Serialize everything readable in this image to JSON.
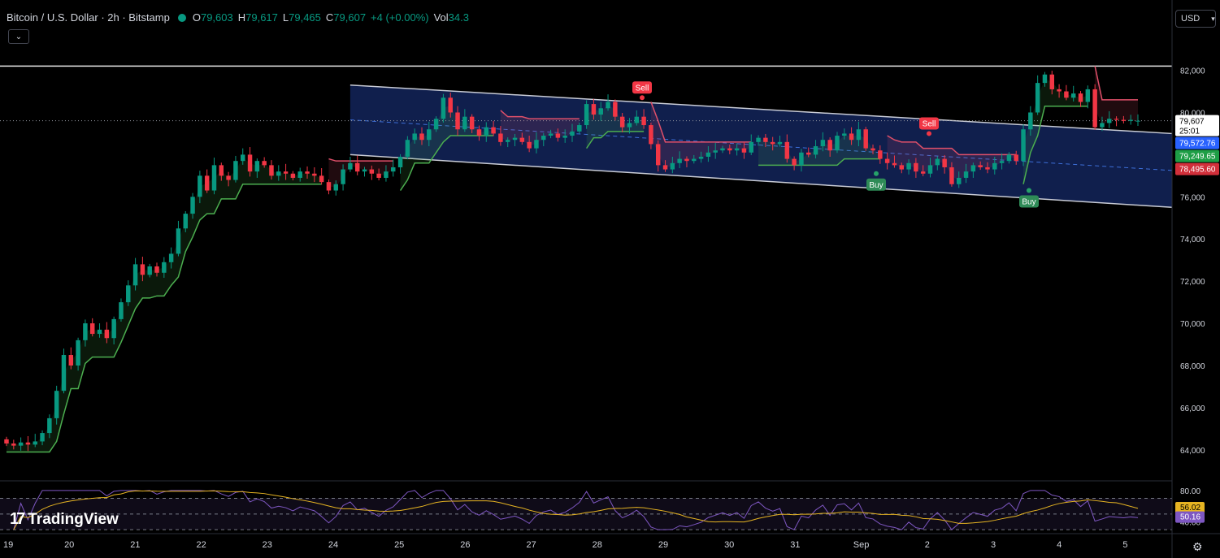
{
  "legend": {
    "symbol": "Bitcoin / U.S. Dollar · 2h · Bitstamp",
    "o_label": "O",
    "o_value": "79,603",
    "h_label": "H",
    "h_value": "79,617",
    "l_label": "L",
    "l_value": "79,465",
    "c_label": "C",
    "c_value": "79,607",
    "change": "+4 (+0.00%)",
    "vol_label": "Vol",
    "vol_value": "34.3"
  },
  "currency": {
    "label": "USD",
    "icon": "chevron-down-icon"
  },
  "collapse_icon": "chevron-down-icon",
  "branding": {
    "logo_text": "TradingView",
    "icon": "tradingview-logo-icon"
  },
  "settings_icon": "gear-icon",
  "colors": {
    "up": "#089981",
    "down": "#f23645",
    "background": "#000000",
    "channel_fill": "#13245a",
    "channel_line": "#c9ccd6",
    "trail_up": "#4caf50",
    "trail_down": "#e0506a",
    "rsi": "#7e57c2",
    "rsi_ma": "#e6b422"
  },
  "chart_data": {
    "type": "candlestick",
    "symbol": "BTCUSD",
    "interval": "2h",
    "x_axis_labels": [
      "19",
      "20",
      "21",
      "22",
      "23",
      "24",
      "25",
      "26",
      "27",
      "28",
      "29",
      "30",
      "31",
      "Sep",
      "2",
      "3",
      "4",
      "5"
    ],
    "y_axis_labels": [
      "82,000",
      "80,000",
      "78,000",
      "76,000",
      "74,000",
      "72,000",
      "70,000",
      "68,000",
      "66,000",
      "64,000"
    ],
    "ylim": [
      62800,
      83100
    ],
    "grid": false,
    "candles": [
      [
        64500,
        64300
      ],
      [
        64300,
        64200
      ],
      [
        64200,
        64350
      ],
      [
        64350,
        64250
      ],
      [
        64250,
        64400
      ],
      [
        64400,
        64800
      ],
      [
        64800,
        65500
      ],
      [
        65500,
        66800
      ],
      [
        66800,
        68500
      ],
      [
        68500,
        68000
      ],
      [
        68000,
        69200
      ],
      [
        69200,
        70000
      ],
      [
        70000,
        69500
      ],
      [
        69500,
        69700
      ],
      [
        69700,
        69300
      ],
      [
        69300,
        70200
      ],
      [
        70200,
        71000
      ],
      [
        71000,
        71800
      ],
      [
        71800,
        72800
      ],
      [
        72800,
        72300
      ],
      [
        72300,
        72700
      ],
      [
        72700,
        72400
      ],
      [
        72400,
        72900
      ],
      [
        72900,
        73300
      ],
      [
        73300,
        74500
      ],
      [
        74500,
        75200
      ],
      [
        75200,
        76000
      ],
      [
        76000,
        77000
      ],
      [
        77000,
        76300
      ],
      [
        76300,
        77500
      ],
      [
        77500,
        77000
      ],
      [
        77000,
        76800
      ],
      [
        76800,
        77700
      ],
      [
        77700,
        78000
      ],
      [
        78000,
        77200
      ],
      [
        77200,
        77700
      ],
      [
        77700,
        77500
      ],
      [
        77500,
        77000
      ],
      [
        77000,
        77200
      ],
      [
        77200,
        77100
      ],
      [
        77100,
        76900
      ],
      [
        76900,
        77200
      ],
      [
        77200,
        77100
      ],
      [
        77100,
        77000
      ],
      [
        77000,
        76700
      ],
      [
        76700,
        76300
      ],
      [
        76300,
        76600
      ],
      [
        76600,
        77300
      ],
      [
        77300,
        77600
      ],
      [
        77600,
        77200
      ],
      [
        77200,
        77300
      ],
      [
        77300,
        77100
      ],
      [
        77100,
        76900
      ],
      [
        76900,
        77200
      ],
      [
        77200,
        77400
      ],
      [
        77400,
        77900
      ],
      [
        77900,
        78700
      ],
      [
        78700,
        79000
      ],
      [
        79000,
        78700
      ],
      [
        78700,
        79200
      ],
      [
        79200,
        79700
      ],
      [
        79700,
        80700
      ],
      [
        80700,
        80000
      ],
      [
        80000,
        79200
      ],
      [
        79200,
        79800
      ],
      [
        79800,
        79200
      ],
      [
        79200,
        78900
      ],
      [
        78900,
        79300
      ],
      [
        79300,
        79000
      ],
      [
        79000,
        78600
      ],
      [
        78600,
        78700
      ],
      [
        78700,
        78800
      ],
      [
        78800,
        78600
      ],
      [
        78600,
        78300
      ],
      [
        78300,
        78700
      ],
      [
        78700,
        78900
      ],
      [
        78900,
        79000
      ],
      [
        79000,
        78800
      ],
      [
        78800,
        78900
      ],
      [
        78900,
        79100
      ],
      [
        79100,
        79400
      ],
      [
        79400,
        80400
      ],
      [
        80400,
        79900
      ],
      [
        79900,
        80200
      ],
      [
        80200,
        80500
      ],
      [
        80500,
        79800
      ],
      [
        79800,
        79300
      ],
      [
        79300,
        79500
      ],
      [
        79500,
        79800
      ],
      [
        79800,
        79400
      ],
      [
        79400,
        78500
      ],
      [
        78500,
        77500
      ],
      [
        77500,
        77300
      ],
      [
        77300,
        77600
      ],
      [
        77600,
        77800
      ],
      [
        77800,
        77700
      ],
      [
        77700,
        77800
      ],
      [
        77800,
        77900
      ],
      [
        77900,
        78100
      ],
      [
        78100,
        78200
      ],
      [
        78200,
        78300
      ],
      [
        78300,
        78200
      ],
      [
        78200,
        78300
      ],
      [
        78300,
        78100
      ],
      [
        78100,
        78600
      ],
      [
        78600,
        78800
      ],
      [
        78800,
        78600
      ],
      [
        78600,
        78500
      ],
      [
        78500,
        78600
      ],
      [
        78600,
        77800
      ],
      [
        77800,
        77500
      ],
      [
        77500,
        78100
      ],
      [
        78100,
        78000
      ],
      [
        78000,
        78400
      ],
      [
        78400,
        78700
      ],
      [
        78700,
        78200
      ],
      [
        78200,
        78900
      ],
      [
        78900,
        79000
      ],
      [
        79000,
        78700
      ],
      [
        78700,
        79200
      ],
      [
        79200,
        78300
      ],
      [
        78300,
        78200
      ],
      [
        78200,
        77800
      ],
      [
        77800,
        77600
      ],
      [
        77600,
        77500
      ],
      [
        77500,
        77300
      ],
      [
        77300,
        77600
      ],
      [
        77600,
        77200
      ],
      [
        77200,
        77100
      ],
      [
        77100,
        77500
      ],
      [
        77500,
        77800
      ],
      [
        77800,
        77400
      ],
      [
        77400,
        76600
      ],
      [
        76600,
        76900
      ],
      [
        76900,
        77200
      ],
      [
        77200,
        77500
      ],
      [
        77500,
        77400
      ],
      [
        77400,
        77300
      ],
      [
        77300,
        77600
      ],
      [
        77600,
        77700
      ],
      [
        77700,
        78000
      ],
      [
        78000,
        77700
      ],
      [
        77700,
        79200
      ],
      [
        79200,
        80000
      ],
      [
        80000,
        81400
      ],
      [
        81400,
        81800
      ],
      [
        81800,
        81100
      ],
      [
        81100,
        81000
      ],
      [
        81000,
        80700
      ],
      [
        80700,
        80900
      ],
      [
        80900,
        80500
      ],
      [
        80500,
        81100
      ],
      [
        81100,
        79300
      ],
      [
        79300,
        79500
      ],
      [
        79500,
        79700
      ],
      [
        79700,
        79650
      ],
      [
        79650,
        79600
      ],
      [
        79600,
        79650
      ],
      [
        79603,
        79607
      ]
    ],
    "indicators": {
      "descending_channel": {
        "upper_start": 81300,
        "upper_end": 79000,
        "lower_start": 78000,
        "lower_end": 75500
      },
      "resistance_line": 82200,
      "signals": [
        {
          "type": "sell",
          "label": "Sell",
          "value": 80700
        },
        {
          "type": "buy",
          "label": "Buy",
          "value": 77100
        },
        {
          "type": "sell",
          "label": "Sell",
          "value": 79000
        },
        {
          "type": "buy",
          "label": "Buy",
          "value": 76300
        }
      ]
    },
    "price_labels": [
      {
        "value": "79,607",
        "sub": "25:01",
        "kind": "last"
      },
      {
        "value": "79,572.76",
        "kind": "blue"
      },
      {
        "value": "79,249.65",
        "kind": "green"
      },
      {
        "value": "78,495.60",
        "kind": "red"
      }
    ],
    "rsi_pane": {
      "y_axis_labels": [
        "80.00",
        "40.00"
      ],
      "rsi_value": "50.16",
      "ma_value": "56.02",
      "levels": [
        70,
        50,
        30
      ]
    }
  }
}
